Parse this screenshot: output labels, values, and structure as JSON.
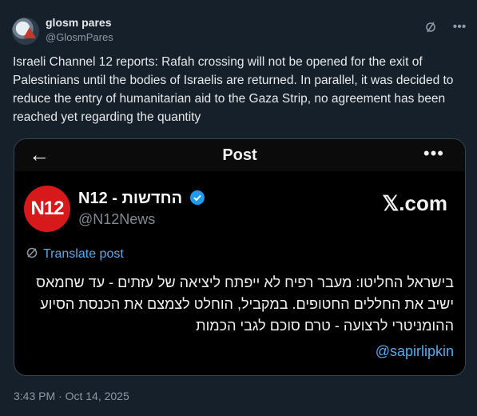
{
  "author": {
    "name": "glosm pares",
    "handle": "@GlosmPares"
  },
  "tweet": {
    "text": "Israeli Channel 12 reports: Rafah crossing will not be opened for the exit of Palestinians until the bodies of Israelis are returned. In parallel, it was decided to reduce the entry of humanitarian aid to the Gaza Strip, no agreement has been reached yet regarding the quantity",
    "timestamp": "3:43 PM · Oct 14, 2025"
  },
  "quoted": {
    "topbar_title": "Post",
    "logo_text": "N12",
    "name": "N12 - החדשות",
    "handle": "@N12News",
    "source": "𝕏.com",
    "translate_label": "Translate post",
    "text": "בישראל החליטו: מעבר רפיח לא ייפתח ליציאה של עזתים - עד שחמאס ישיב את החללים החטופים. במקביל, הוחלט לצמצם את הכנסת הסיוע ההומניטרי לרצועה - טרם סוכם לגבי הכמות",
    "mention": "@sapirlipkin"
  },
  "colors": {
    "background": "#15202b",
    "link": "#5aa9ea",
    "n12_red": "#d7191c",
    "verified": "#1d9bf0"
  },
  "icons": [
    "grok-icon",
    "more-icon",
    "back-arrow-icon",
    "verified-badge-icon",
    "translate-icon"
  ]
}
